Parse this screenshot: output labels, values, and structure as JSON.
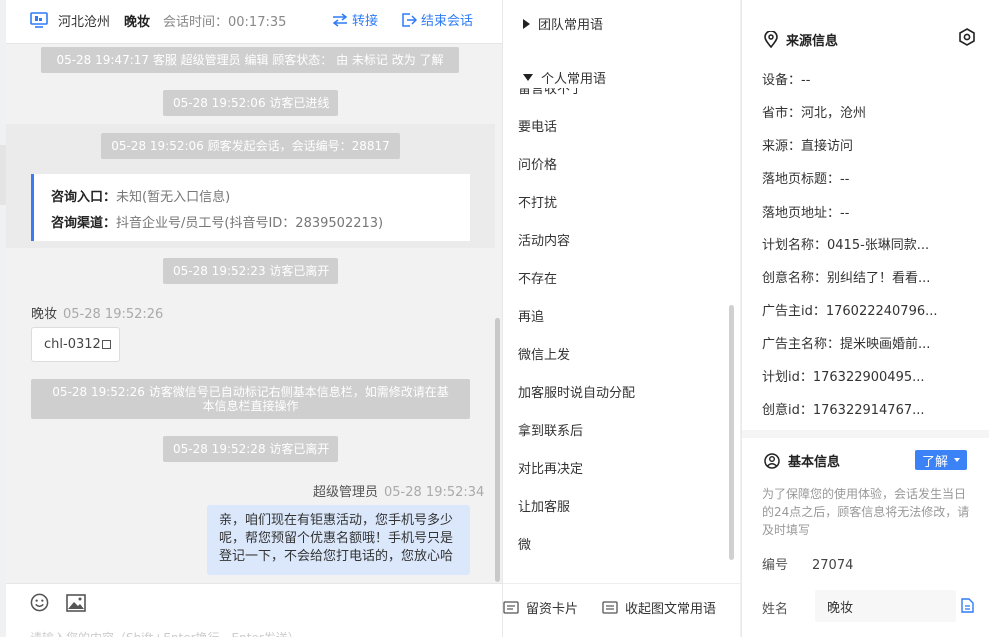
{
  "header": {
    "location": "河北沧州",
    "visitor_name": "晚妆",
    "session_time": "会话时间：00:17:35",
    "transfer_label": "转接",
    "end_label": "结束会话"
  },
  "messages": {
    "sys_status_change": "05-28 19:47:17 客服 超级管理员 编辑 顾客状态： 由 未标记 改为 了解",
    "sys_enter": "05-28 19:52:06 访客已进线",
    "sys_session": "05-28 19:52:06 顾客发起会话，会话编号：28817",
    "info_card": {
      "entry_label": "咨询入口：",
      "entry_value": "未知(暂无入口信息)",
      "channel_label": "咨询渠道：",
      "channel_value": "抖音企业号/员工号(抖音号ID：2839502213)"
    },
    "sys_leave_1": "05-28 19:52:23 访客已离开",
    "visitor_name": "晚妆",
    "visitor_time": "05-28 19:52:26",
    "visitor_text": "chl-0312",
    "sys_wechat_line1": "05-28 19:52:26 访客微信号已自动标记右侧基本信息栏，如需修改请在基",
    "sys_wechat_line2": "本信息栏直接操作",
    "sys_leave_2": "05-28 19:52:28 访客已离开",
    "agent_name": "超级管理员",
    "agent_time": "05-28 19:52:34",
    "agent_line1": "亲，咱们现在有钜惠活动，您手机号多少",
    "agent_line2": "呢，帮您预留个优惠名额哦！手机号只是",
    "agent_line3": "登记一下，不会给您打电话的，您放心哈"
  },
  "input": {
    "placeholder": "请输入您的内容（Shift+Enter换行，Enter发送）"
  },
  "phrases": {
    "team_group": "团队常用语",
    "personal_group": "个人常用语",
    "clipped": "留言收不了",
    "items": [
      "要电话",
      "问价格",
      "不打扰",
      "活动内容",
      "不存在",
      "再追",
      "微信上发",
      "加客服时说自动分配",
      "拿到联系后",
      "对比再决定",
      "让加客服",
      "微"
    ],
    "card_button": "留资卡片",
    "collect_button": "收起图文常用语"
  },
  "source": {
    "title": "来源信息",
    "rows": [
      "设备：--",
      "省市：河北，沧州",
      "来源：直接访问",
      "落地页标题：--",
      "落地页地址：--",
      "计划名称：0415-张琳同款...",
      "创意名称：别纠结了！看看...",
      "广告主id：176022240796...",
      "广告主名称：提米映画婚前...",
      "计划id：176322900495...",
      "创意id：176322914767..."
    ]
  },
  "basic": {
    "title": "基本信息",
    "status": "了解",
    "notice": "为了保障您的使用体验，会话发生当日的24点之后，顾客信息将无法修改，请及时填写",
    "id_label": "编号",
    "id_value": "27074",
    "name_label": "姓名",
    "name_value": "晚妆"
  }
}
